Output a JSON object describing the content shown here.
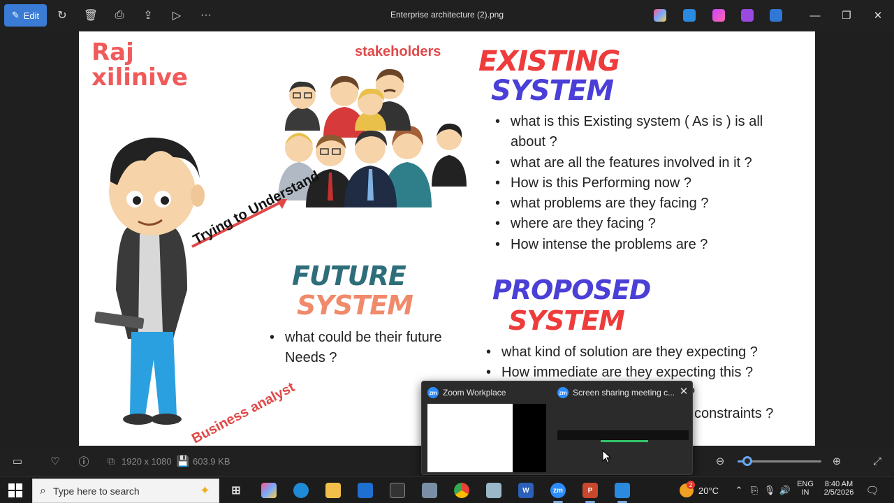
{
  "viewer": {
    "edit_label": "Edit",
    "file_title": "Enterprise architecture (2).png",
    "image_dimensions": "1920 x 1080",
    "file_size": "603.9 KB",
    "zoom_percent": 12
  },
  "slide": {
    "brand_line1": "Raj",
    "brand_line2": "xilinive",
    "stakeholders_label": "stakeholders",
    "trying_label": "Trying  to Understand",
    "business_analyst_label": "Business analyst",
    "existing": {
      "heading_line1": "EXISTING",
      "heading_line2": "SYSTEM",
      "bullets": [
        "what is this Existing  system ( As is ) is all about ?",
        "what are all the features involved in it ?",
        "How is this Performing now ?",
        "what problems are they facing ?",
        "where are they  facing ?",
        "How intense the problems are ?"
      ]
    },
    "future": {
      "heading_line1": "FUTURE",
      "heading_line2": "SYSTEM",
      "bullets": [
        "what could be their future Needs ?"
      ]
    },
    "proposed": {
      "heading_line1": "PROPOSED",
      "heading_line2": "SYSTEM",
      "bullets": [
        "what kind of solution are they expecting ?",
        "How immediate are they expecting this ?",
        "?",
        "constraints ?"
      ]
    }
  },
  "zoom_popup": {
    "left_title": "Zoom Workplace",
    "right_title": "Screen sharing meeting c...",
    "badge": "zm"
  },
  "taskbar": {
    "search_placeholder": "Type here to search",
    "temperature": "20°C",
    "language_line1": "ENG",
    "language_line2": "IN",
    "time": "8:40 AM",
    "date": "2/5/2026",
    "weather_badge": "2"
  }
}
